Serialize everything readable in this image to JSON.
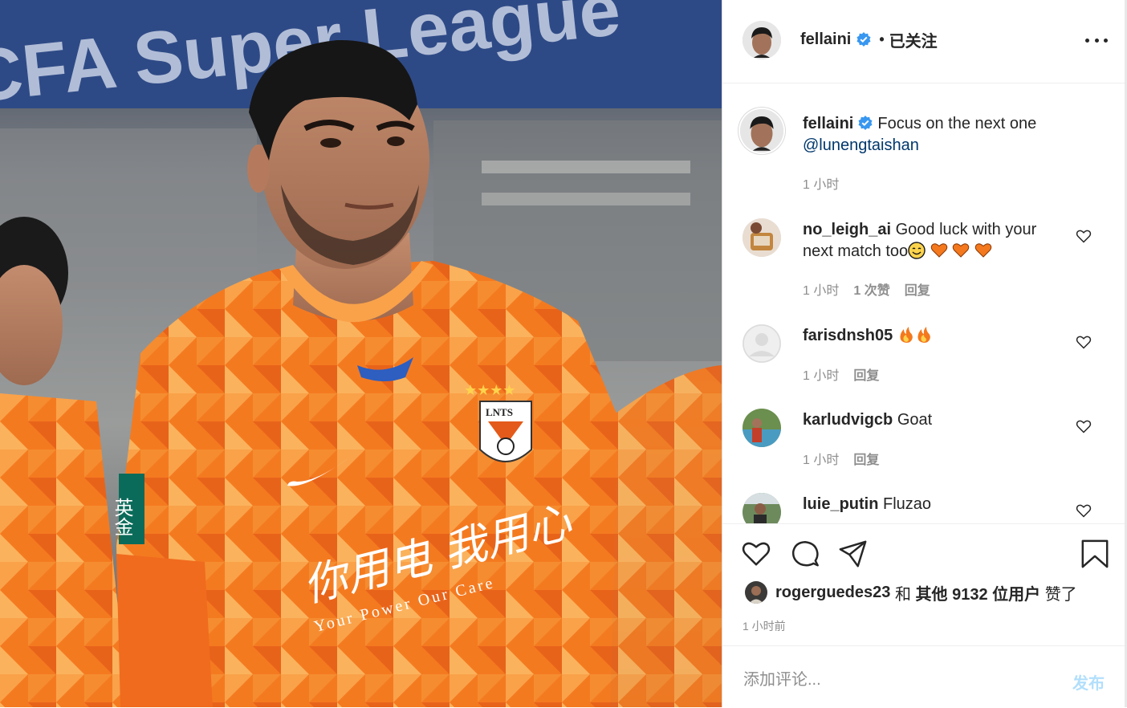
{
  "header": {
    "username": "fellaini",
    "separator": "•",
    "follow_status": "已关注",
    "more_icon": "more-horizontal-icon"
  },
  "caption": {
    "username": "fellaini",
    "text": "Focus on the next one",
    "mention": "@lunengtaishan",
    "time": "1 小时"
  },
  "comments": [
    {
      "username": "no_leigh_ai",
      "text": "Good luck with your next match too",
      "emojis": [
        "smiling-face-emoji",
        "orange-heart-emoji",
        "orange-heart-emoji",
        "orange-heart-emoji"
      ],
      "time": "1 小时",
      "likes": "1 次赞",
      "reply": "回复"
    },
    {
      "username": "farisdnsh05",
      "text": "",
      "emojis": [
        "fire-emoji",
        "fire-emoji"
      ],
      "time": "1 小时",
      "reply": "回复"
    },
    {
      "username": "karludvigcb",
      "text": "Goat",
      "time": "1 小时",
      "reply": "回复"
    },
    {
      "username": "luie_putin",
      "text": "Fluzao"
    }
  ],
  "actions": {
    "like_icon": "heart-icon",
    "comment_icon": "comment-icon",
    "share_icon": "send-icon",
    "save_icon": "bookmark-icon"
  },
  "likes": {
    "user": "rogerguedes23",
    "connector": "和",
    "others": "其他 9132 位用户",
    "suffix": "赞了"
  },
  "timestamp": "1 小时前",
  "add_comment": {
    "placeholder": "添加评论...",
    "post_label": "发布"
  },
  "photo": {
    "banner_text": "CFA Super League",
    "sponsor_text_cn": "你用电 我用心",
    "sponsor_text_en": "Your Power Our Care",
    "crest_text": "LNTS",
    "sleeve_text": "英金"
  },
  "colors": {
    "verified": "#3897f0",
    "jersey_orange": "#f47a20",
    "mention": "#00376b",
    "post_button_disabled": "#b2dffc"
  }
}
